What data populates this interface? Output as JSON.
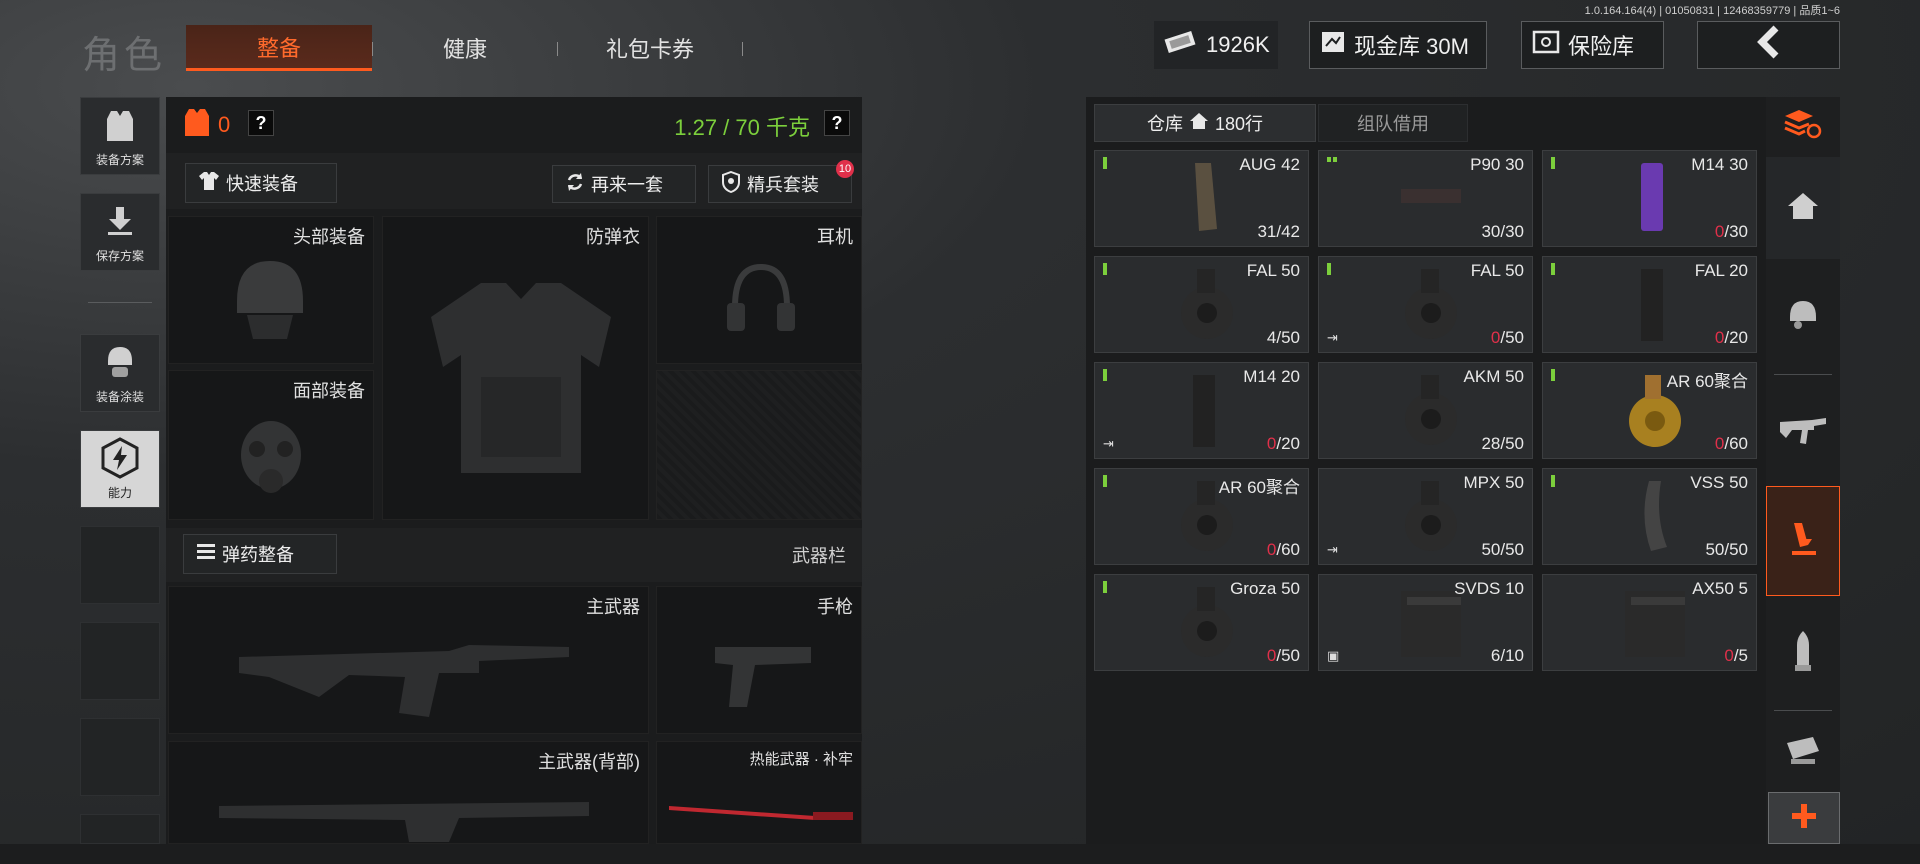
{
  "version": "1.0.164.164(4) | 01050831 | 12468359779 | 品质1~6",
  "header": {
    "title": "角色",
    "tabs": [
      "整备",
      "健康",
      "礼包卡券"
    ],
    "currency": "1926K",
    "cash_vault": "现金库 30M",
    "safe": "保险库"
  },
  "left_rail": {
    "buttons": [
      "装备方案",
      "保存方案",
      "装备涂装",
      "能力"
    ]
  },
  "loadout": {
    "armor_count": "0",
    "weight": "1.27 / 70 千克",
    "quick_equip": "快速装备",
    "again_set": "再来一套",
    "elite_set": "精兵套装",
    "elite_badge": "10",
    "slots": {
      "head": "头部装备",
      "armor": "防弹衣",
      "headset": "耳机",
      "face": "面部装备",
      "primary": "主武器",
      "pistol": "手枪",
      "primary_back": "主武器(背部)",
      "melee": "热能武器 · 补牢"
    },
    "ammo_button": "弹药整备",
    "weapon_bar": "武器栏"
  },
  "storage": {
    "tab_warehouse": "仓库",
    "rows": "180行",
    "tab_team": "组队借用",
    "items": [
      {
        "name": "AUG 42",
        "cur": "31",
        "max": "/42",
        "dots": "v",
        "corner": "",
        "shape": "aug"
      },
      {
        "name": "P90 30",
        "cur": "30",
        "max": "/30",
        "dots": "h",
        "corner": "",
        "shape": "p90"
      },
      {
        "name": "M14 30",
        "cur": "0",
        "max": "/30",
        "dots": "v",
        "corner": "",
        "shape": "m14p"
      },
      {
        "name": "FAL 50",
        "cur": "4",
        "max": "/50",
        "dots": "v",
        "corner": "",
        "shape": "drum"
      },
      {
        "name": "FAL 50",
        "cur": "0",
        "max": "/50",
        "dots": "v",
        "corner": "⇥",
        "shape": "drum"
      },
      {
        "name": "FAL 20",
        "cur": "0",
        "max": "/20",
        "dots": "v",
        "corner": "",
        "shape": "mag"
      },
      {
        "name": "M14 20",
        "cur": "0",
        "max": "/20",
        "dots": "v",
        "corner": "⇥",
        "shape": "mag"
      },
      {
        "name": "AKM 50",
        "cur": "28",
        "max": "/50",
        "dots": "",
        "corner": "",
        "shape": "drum"
      },
      {
        "name": "AR 60聚合",
        "cur": "0",
        "max": "/60",
        "dots": "v",
        "corner": "",
        "shape": "golddrum"
      },
      {
        "name": "AR 60聚合",
        "cur": "0",
        "max": "/60",
        "dots": "v",
        "corner": "",
        "shape": "drum"
      },
      {
        "name": "MPX 50",
        "cur": "50",
        "max": "/50",
        "dots": "",
        "corner": "⇥",
        "shape": "drum"
      },
      {
        "name": "VSS 50",
        "cur": "50",
        "max": "/50",
        "dots": "v",
        "corner": "",
        "shape": "curve"
      },
      {
        "name": "Groza 50",
        "cur": "0",
        "max": "/50",
        "dots": "v",
        "corner": "",
        "shape": "drum"
      },
      {
        "name": "SVDS 10",
        "cur": "6",
        "max": "/10",
        "dots": "",
        "corner": "▣",
        "shape": "box"
      },
      {
        "name": "AX50 5",
        "cur": "0",
        "max": "/5",
        "dots": "",
        "corner": "",
        "shape": "box"
      }
    ]
  },
  "colors": {
    "accent": "#ff5a1e",
    "weight_green": "#7ccf3c",
    "zero_red": "#e0304a"
  }
}
